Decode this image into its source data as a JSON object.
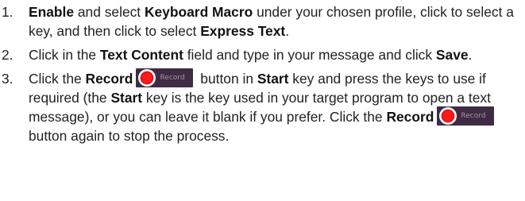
{
  "steps": [
    {
      "number": "1.",
      "parts": [
        {
          "b": "Enable"
        },
        {
          "t": " and select "
        },
        {
          "b": "Keyboard Macro"
        },
        {
          "t": " under your chosen profile, click to select a key, and then click to select "
        },
        {
          "b": "Express Text"
        },
        {
          "t": "."
        }
      ]
    },
    {
      "number": "2.",
      "parts": [
        {
          "t": "Click in the "
        },
        {
          "b": "Text Content"
        },
        {
          "t": " field and type in your message and click "
        },
        {
          "b": "Save"
        },
        {
          "t": "."
        }
      ]
    },
    {
      "number": "3.",
      "parts": [
        {
          "t": "Click the "
        },
        {
          "b": "Record"
        },
        {
          "icon": "record-button",
          "label": "Record"
        },
        {
          "t": " button in "
        },
        {
          "b": "Start"
        },
        {
          "t": " key and press the keys to use if required (the "
        },
        {
          "b": "Start"
        },
        {
          "t": " key is the key used in your target program to open a text message), or you can leave it blank if you prefer. Click the "
        },
        {
          "b": "Record"
        },
        {
          "icon": "record-button",
          "label": "Record"
        },
        {
          "t": " button again to stop the process."
        }
      ]
    }
  ],
  "colors": {
    "text": "#222222",
    "record_button_bg": "#3f2c44",
    "record_dot": "#ff1a1a"
  }
}
